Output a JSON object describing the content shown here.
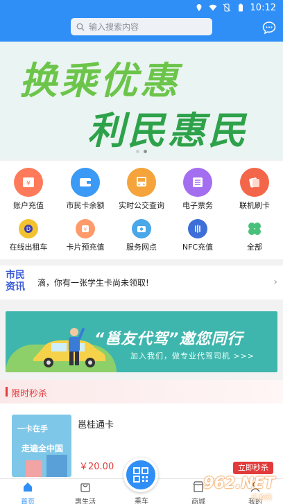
{
  "status_bar": {
    "time": "10:12",
    "icons": [
      "location-icon",
      "wifi-icon",
      "no-sim-icon",
      "battery-icon"
    ]
  },
  "header": {
    "search_placeholder": "输入搜索内容",
    "message_icon": "chat-bubble-icon",
    "background_color": "#2f8ff7"
  },
  "banner": {
    "line1": "换乘优惠",
    "line2": "利民惠民",
    "slide_index": 2,
    "slide_count": 2
  },
  "quick_grid": [
    {
      "label": "账户充值",
      "icon": "wallet-yen-icon",
      "color": "#ff7a5a"
    },
    {
      "label": "市民卡余额",
      "icon": "card-wallet-icon",
      "color": "#3a9af5"
    },
    {
      "label": "实时公交查询",
      "icon": "bus-icon",
      "color": "#f5a33b"
    },
    {
      "label": "电子票务",
      "icon": "ticket-icon",
      "color": "#a46ef0"
    },
    {
      "label": "联机刷卡",
      "icon": "card-swipe-icon",
      "color": "#f4664a"
    },
    {
      "label": "在线出租车",
      "icon": "taxi-icon",
      "color": "#f2c230"
    },
    {
      "label": "卡片预充值",
      "icon": "card-precharge-icon",
      "color": "#ff9a6a"
    },
    {
      "label": "服务网点",
      "icon": "service-point-icon",
      "color": "#4aa7e8"
    },
    {
      "label": "NFC充值",
      "icon": "nfc-icon",
      "color": "#3e6fd8"
    },
    {
      "label": "全部",
      "icon": "all-apps-icon",
      "color": "#49c07a"
    }
  ],
  "news": {
    "tag_line1": "市民",
    "tag_line2": "资讯",
    "text": "滴，你有一张学生卡尚未领取!"
  },
  "ad": {
    "title": "“邕友代驾”邀您同行",
    "subtitle": "加入我们，做专业代驾司机 >>>"
  },
  "flash_sale": {
    "title": "限时秒杀",
    "product": {
      "name": "邕桂通卡",
      "image_text_1": "一卡在手",
      "image_text_2": "走遍全中国",
      "price": "￥20.00",
      "button": "立即秒杀"
    }
  },
  "tabbar": {
    "tabs": [
      {
        "label": "首页",
        "icon": "home-icon",
        "active": true
      },
      {
        "label": "惠生活",
        "icon": "shopping-bag-icon",
        "active": false
      },
      {
        "label": "乘车",
        "icon": "qr-code-icon",
        "active": false
      },
      {
        "label": "商城",
        "icon": "store-icon",
        "active": false
      },
      {
        "label": "我的",
        "icon": "profile-icon",
        "active": false
      }
    ]
  },
  "watermark": {
    "brand": "962.NET",
    "sub": "乐游网"
  }
}
